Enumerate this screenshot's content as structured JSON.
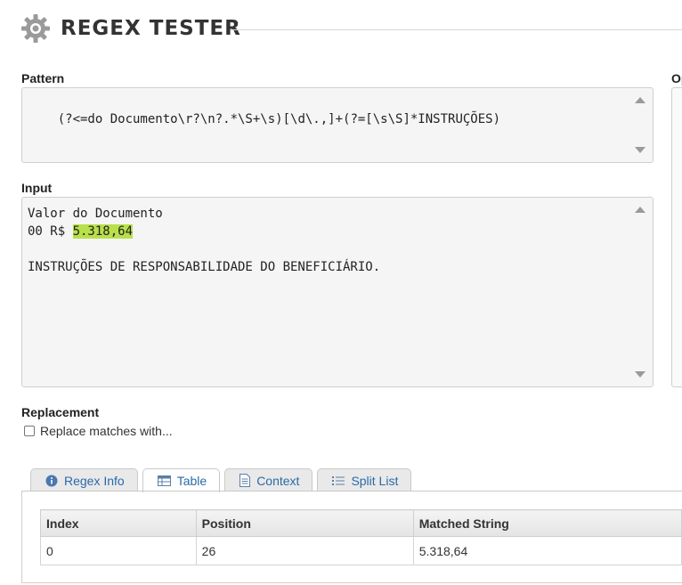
{
  "header": {
    "title": "REGEX TESTER"
  },
  "pattern": {
    "label": "Pattern",
    "value": "(?<=do Documento\\r?\\n?.*\\S+\\s)[\\d\\.,]+(?=[\\s\\S]*INSTRUÇÕES)"
  },
  "options": {
    "label": "Op"
  },
  "input": {
    "label": "Input",
    "line1": "Valor do Documento",
    "line2_prefix": "00 R$ ",
    "line2_match": "5.318,64",
    "line3": "",
    "line4": "INSTRUÇÕES DE RESPONSABILIDADE DO BENEFICIÁRIO.",
    "match_color": "#b8e04a"
  },
  "replacement": {
    "label": "Replacement",
    "checkbox_label": "Replace matches with...",
    "checked": false
  },
  "tabs": [
    {
      "label": "Regex Info",
      "icon": "info-icon",
      "active": false
    },
    {
      "label": "Table",
      "icon": "table-icon",
      "active": true
    },
    {
      "label": "Context",
      "icon": "document-icon",
      "active": false
    },
    {
      "label": "Split List",
      "icon": "list-icon",
      "active": false
    }
  ],
  "results": {
    "columns": [
      "Index",
      "Position",
      "Matched String"
    ],
    "rows": [
      [
        "0",
        "26",
        "5.318,64"
      ]
    ]
  },
  "colors": {
    "link": "#2a6aa8",
    "highlight": "#b8e04a"
  }
}
